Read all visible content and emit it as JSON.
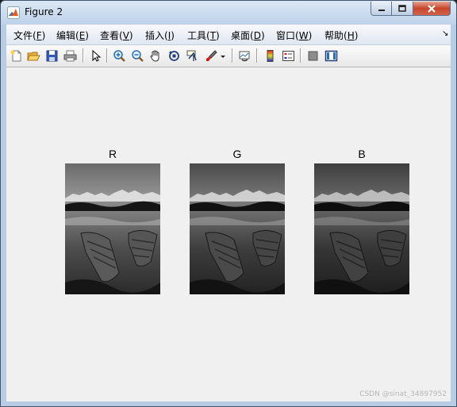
{
  "window": {
    "title": "Figure 2",
    "controls": {
      "minimize": "minimize",
      "maximize": "maximize",
      "close": "close"
    }
  },
  "menu": {
    "items": [
      {
        "label": "文件(",
        "key": "F",
        "suffix": ")"
      },
      {
        "label": "编辑(",
        "key": "E",
        "suffix": ")"
      },
      {
        "label": "查看(",
        "key": "V",
        "suffix": ")"
      },
      {
        "label": "插入(",
        "key": "I",
        "suffix": ")"
      },
      {
        "label": "工具(",
        "key": "T",
        "suffix": ")"
      },
      {
        "label": "桌面(",
        "key": "D",
        "suffix": ")"
      },
      {
        "label": "窗口(",
        "key": "W",
        "suffix": ")"
      },
      {
        "label": "帮助(",
        "key": "H",
        "suffix": ")"
      }
    ],
    "overflow_icon": "chevron-down-icon"
  },
  "toolbar": {
    "icons": [
      "new-figure-icon",
      "open-icon",
      "save-icon",
      "print-icon",
      "pointer-icon",
      "zoom-in-icon",
      "zoom-out-icon",
      "pan-hand-icon",
      "rotate-3d-icon",
      "data-cursor-icon",
      "brush-icon",
      "brush-dropdown-icon",
      "link-plot-icon",
      "colorbar-icon",
      "legend-icon",
      "hide-plot-tools-icon",
      "show-plot-tools-icon"
    ]
  },
  "figure": {
    "axes": [
      {
        "title": "R",
        "channel": "red"
      },
      {
        "title": "G",
        "channel": "green"
      },
      {
        "title": "B",
        "channel": "blue"
      }
    ],
    "watermark": "CSDN @sinat_34897952",
    "background": "#f0f0f0"
  }
}
